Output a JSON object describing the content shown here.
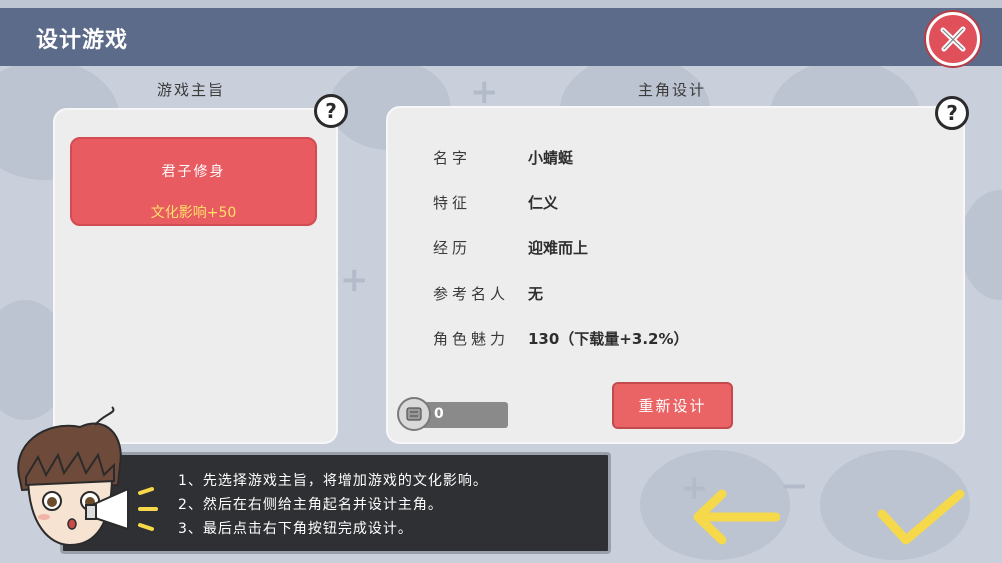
{
  "header": {
    "title": "设计游戏",
    "close_icon": "close-x-icon"
  },
  "theme_section": {
    "label": "游戏主旨",
    "cards": [
      {
        "name": "君子修身",
        "effect": "文化影响+50"
      }
    ]
  },
  "protagonist_section": {
    "label": "主角设计",
    "rows": [
      {
        "label": "名字",
        "value": "小蜻蜓"
      },
      {
        "label": "特征",
        "value": "仁义"
      },
      {
        "label": "经历",
        "value": "迎难而上"
      },
      {
        "label": "参考名人",
        "value": "无"
      },
      {
        "label": "角色魅力",
        "value": "130（下载量+3.2%）"
      }
    ],
    "coin_value": "0",
    "redesign_label": "重新设计"
  },
  "tips": [
    "1、先选择游戏主旨，将增加游戏的文化影响。",
    "2、然后在右侧给主角起名并设计主角。",
    "3、最后点击右下角按钮完成设计。"
  ],
  "colors": {
    "header": "#5d6b8a",
    "accent_red": "#e85b60",
    "arrow_yellow": "#f5d94a",
    "panel": "#ededed"
  }
}
